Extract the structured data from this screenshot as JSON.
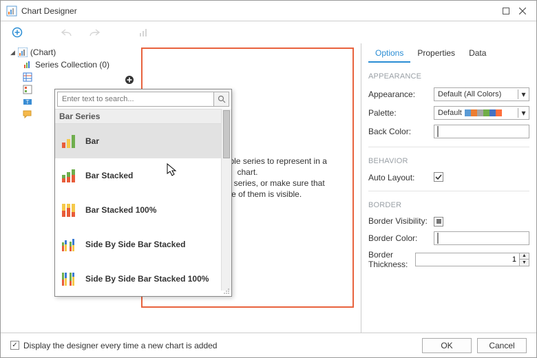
{
  "window": {
    "title": "Chart Designer"
  },
  "tree": {
    "root": "(Chart)",
    "series": "Series Collection (0)"
  },
  "preview": {
    "line1": "There are no visible series to represent in a chart.",
    "line2": "Try to add a new series, or make sure that",
    "line3": "at least one of them is visible."
  },
  "panel": {
    "tabs": {
      "options": "Options",
      "properties": "Properties",
      "data": "Data"
    },
    "sections": {
      "appearance": "APPEARANCE",
      "behavior": "BEHAVIOR",
      "border": "BORDER"
    },
    "labels": {
      "appearance": "Appearance:",
      "palette": "Palette:",
      "backcolor": "Back Color:",
      "autolayout": "Auto Layout:",
      "bvis": "Border Visibility:",
      "bcolor": "Border Color:",
      "bthick": "Border Thickness:"
    },
    "values": {
      "appearance": "Default (All Colors)",
      "palette": "Default",
      "bthick": "1"
    },
    "palette_colors": [
      "#5b9bd5",
      "#ed7d31",
      "#a5a5a5",
      "#70ad47",
      "#4472c4",
      "#ff6f3c"
    ]
  },
  "popup": {
    "placeholder": "Enter text to search...",
    "group": "Bar Series",
    "items": [
      {
        "label": "Bar"
      },
      {
        "label": "Bar Stacked"
      },
      {
        "label": "Bar Stacked 100%"
      },
      {
        "label": "Side By Side Bar Stacked"
      },
      {
        "label": "Side By Side Bar Stacked 100%"
      }
    ]
  },
  "footer": {
    "checkbox": "Display the designer every time a new chart is added",
    "ok": "OK",
    "cancel": "Cancel"
  }
}
